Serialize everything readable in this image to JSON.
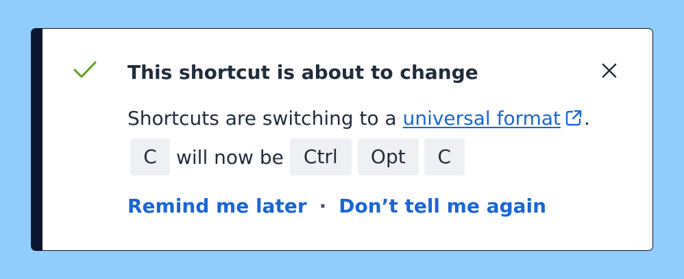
{
  "flag": {
    "title": "This shortcut is about to change",
    "message_prefix": "Shortcuts are switching to a ",
    "link_text": "universal format",
    "message_suffix": ".",
    "old_key": "C",
    "will_now_be": "will now be",
    "new_keys": [
      "Ctrl",
      "Opt",
      "C"
    ],
    "actions": {
      "remind_later": "Remind me later",
      "separator": "·",
      "dont_tell_again": "Don’t tell me again"
    },
    "icons": {
      "status": "checkmark-icon",
      "close": "close-icon",
      "external_link": "external-link-icon"
    }
  },
  "colors": {
    "background": "#90cdfd",
    "accent_bar": "#0b1530",
    "success": "#5ba31e",
    "link": "#1b66d6",
    "text": "#222c3a",
    "key_bg": "#eef0f3"
  }
}
